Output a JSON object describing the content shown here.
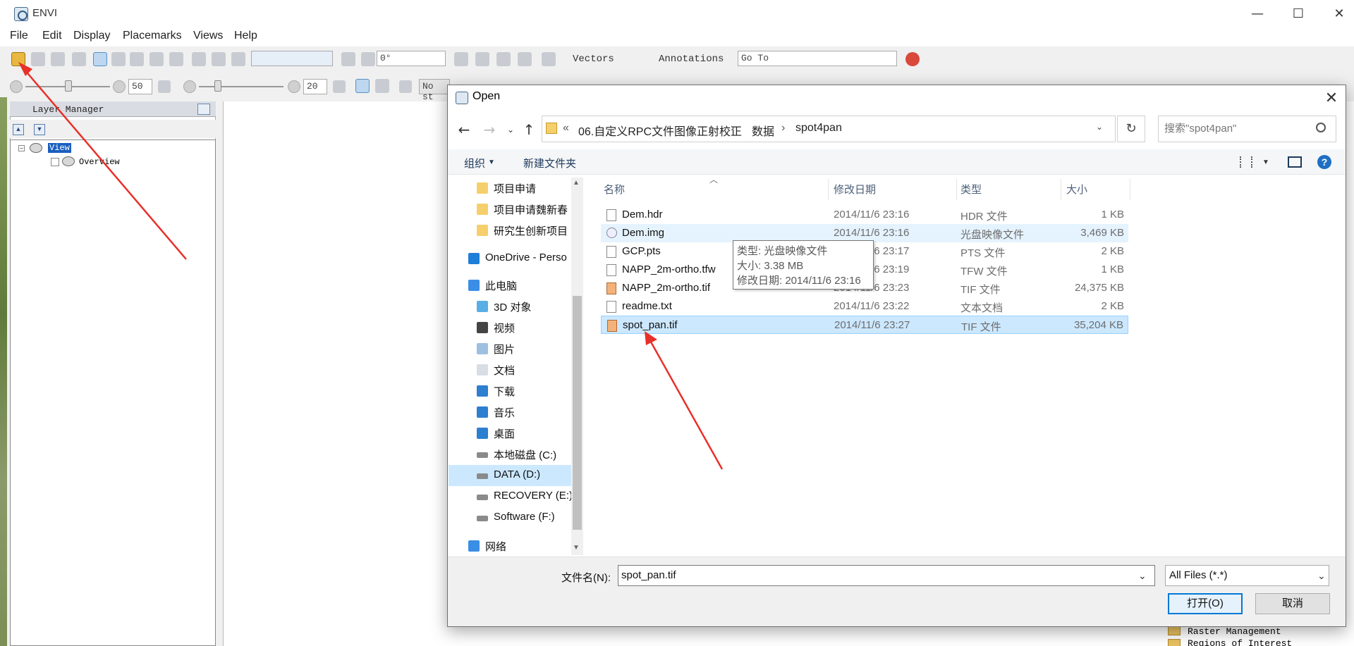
{
  "app": {
    "title": "ENVI",
    "window_controls": [
      "—",
      "☐",
      "✕"
    ]
  },
  "menu": [
    "File",
    "Edit",
    "Display",
    "Placemarks",
    "Views",
    "Help"
  ],
  "toolbar": {
    "zoom_field": "",
    "rotation_field": "0°",
    "vectors_label": "Vectors",
    "annotations_label": "Annotations",
    "goto_placeholder": "Go To",
    "brightness_value": "50",
    "contrast_value": "20",
    "stretch_field": "No st"
  },
  "layer_manager": {
    "title": "Layer Manager",
    "items": [
      {
        "label": "View",
        "selected": true
      },
      {
        "label": "Overview",
        "selected": false
      }
    ]
  },
  "right_tree": [
    "Raster Management",
    "Regions of Interest"
  ],
  "dialog": {
    "title": "Open",
    "breadcrumbs": [
      "«",
      "06.自定义RPC文件图像正射校正",
      "数据",
      "spot4pan"
    ],
    "search_placeholder": "搜索\"spot4pan\"",
    "commands": {
      "organize": "组织",
      "new_folder": "新建文件夹"
    },
    "nav_items": [
      {
        "label": "项目申请",
        "icon": "folder-icon",
        "selected": false
      },
      {
        "label": "项目申请魏新春",
        "icon": "folder-icon",
        "selected": false
      },
      {
        "label": "研究生创新项目",
        "icon": "folder-icon",
        "selected": false
      },
      {
        "label": "OneDrive - Perso",
        "icon": "cloud-icon",
        "selected": false
      },
      {
        "label": "此电脑",
        "icon": "computer-icon",
        "selected": false
      },
      {
        "label": "3D 对象",
        "icon": "cube-icon",
        "selected": false
      },
      {
        "label": "视频",
        "icon": "video-icon",
        "selected": false
      },
      {
        "label": "图片",
        "icon": "picture-icon",
        "selected": false
      },
      {
        "label": "文档",
        "icon": "document-icon",
        "selected": false
      },
      {
        "label": "下载",
        "icon": "download-icon",
        "selected": false
      },
      {
        "label": "音乐",
        "icon": "music-icon",
        "selected": false
      },
      {
        "label": "桌面",
        "icon": "desktop-icon",
        "selected": false
      },
      {
        "label": "本地磁盘 (C:)",
        "icon": "drive-icon",
        "selected": false
      },
      {
        "label": "DATA (D:)",
        "icon": "drive-icon",
        "selected": true
      },
      {
        "label": "RECOVERY (E:)",
        "icon": "drive-icon",
        "selected": false
      },
      {
        "label": "Software (F:)",
        "icon": "drive-icon",
        "selected": false
      },
      {
        "label": "网络",
        "icon": "network-icon",
        "selected": false
      }
    ],
    "columns": {
      "name": "名称",
      "date": "修改日期",
      "type": "类型",
      "size": "大小"
    },
    "files": [
      {
        "name": "Dem.hdr",
        "date": "2014/11/6 23:16",
        "type": "HDR 文件",
        "size": "1 KB",
        "icon": "file-icon",
        "state": "normal"
      },
      {
        "name": "Dem.img",
        "date": "2014/11/6 23:16",
        "type": "光盘映像文件",
        "size": "3,469 KB",
        "icon": "disc-image-icon",
        "state": "hover"
      },
      {
        "name": "GCP.pts",
        "date": "2014/11/6 23:17",
        "type": "PTS 文件",
        "size": "2 KB",
        "icon": "file-icon",
        "state": "normal"
      },
      {
        "name": "NAPP_2m-ortho.tfw",
        "date": "2014/11/6 23:19",
        "type": "TFW 文件",
        "size": "1 KB",
        "icon": "file-icon",
        "state": "normal"
      },
      {
        "name": "NAPP_2m-ortho.tif",
        "date": "2014/11/6 23:23",
        "type": "TIF 文件",
        "size": "24,375 KB",
        "icon": "tif-image-icon",
        "state": "normal"
      },
      {
        "name": "readme.txt",
        "date": "2014/11/6 23:22",
        "type": "文本文档",
        "size": "2 KB",
        "icon": "text-file-icon",
        "state": "normal"
      },
      {
        "name": "spot_pan.tif",
        "date": "2014/11/6 23:27",
        "type": "TIF 文件",
        "size": "35,204 KB",
        "icon": "tif-image-icon",
        "state": "selected"
      }
    ],
    "tooltip": [
      "类型: 光盘映像文件",
      "大小: 3.38 MB",
      "修改日期: 2014/11/6 23:16"
    ],
    "filename_label": "文件名(N):",
    "filename_value": "spot_pan.tif",
    "filter": "All Files (*.*)",
    "open_label": "打开(O)",
    "cancel_label": "取消"
  },
  "colors": {
    "accent": "#0078d7",
    "selection": "#cce8ff",
    "annotation_arrow": "#e8302a"
  }
}
